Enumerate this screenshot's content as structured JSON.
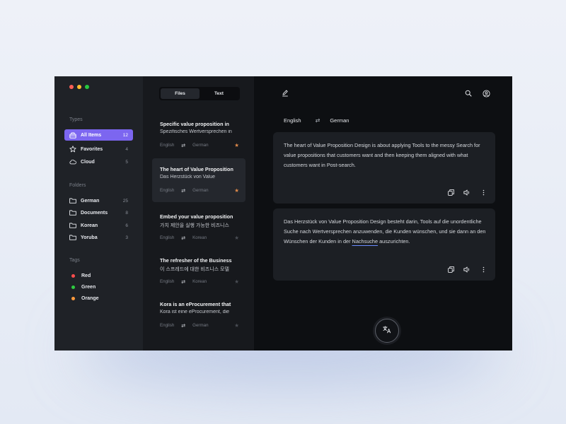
{
  "window": {
    "traffic_lights": [
      {
        "name": "close",
        "color": "#ff5f56"
      },
      {
        "name": "minimize",
        "color": "#ffbd2e"
      },
      {
        "name": "zoom",
        "color": "#27c93f"
      }
    ]
  },
  "sidebar": {
    "types_title": "Types",
    "types": [
      {
        "label": "All Items",
        "count": "12",
        "icon": "inbox-icon",
        "active": true
      },
      {
        "label": "Favorites",
        "count": "4",
        "icon": "star-icon",
        "active": false
      },
      {
        "label": "Cloud",
        "count": "5",
        "icon": "cloud-icon",
        "active": false
      }
    ],
    "folders_title": "Folders",
    "folders": [
      {
        "label": "German",
        "count": "25",
        "icon": "folder-icon"
      },
      {
        "label": "Documents",
        "count": "8",
        "icon": "folder-icon"
      },
      {
        "label": "Korean",
        "count": "6",
        "icon": "folder-icon"
      },
      {
        "label": "Yoruba",
        "count": "3",
        "icon": "folder-icon"
      }
    ],
    "tags_title": "Tags",
    "tags": [
      {
        "label": "Red",
        "color": "#ff4d4d"
      },
      {
        "label": "Green",
        "color": "#2ecc40"
      },
      {
        "label": "Orange",
        "color": "#ff9a3c"
      }
    ]
  },
  "list": {
    "tabs": [
      {
        "label": "Files",
        "active": true
      },
      {
        "label": "Text",
        "active": false
      }
    ],
    "items": [
      {
        "title": "Specific value proposition in",
        "subtitle": "Spezifisches Wertversprechen in",
        "from": "English",
        "to": "German",
        "favorite": true,
        "selected": false
      },
      {
        "title": "The heart of Value Proposition",
        "subtitle": "Das Herzstück von Value",
        "from": "English",
        "to": "German",
        "favorite": true,
        "selected": true
      },
      {
        "title": "Embed your value proposition",
        "subtitle": "가치 제안을 실행 가능한 비즈니스",
        "from": "English",
        "to": "Korean",
        "favorite": false,
        "selected": false
      },
      {
        "title": "The refresher of the Business",
        "subtitle": "이 스프레드에 대한 비즈니스 모델",
        "from": "English",
        "to": "Korean",
        "favorite": false,
        "selected": false
      },
      {
        "title": "Kora is an eProcurement that",
        "subtitle": "Kora ist eine eProcurement, die",
        "from": "English",
        "to": "German",
        "favorite": false,
        "selected": false
      }
    ]
  },
  "main": {
    "source_lang": "English",
    "target_lang": "German",
    "source_text": "The heart of Value Proposition Design is about applying Tools to the messy Search for value propositions that customers want and then keeping them aligned with what customers want in Post-search.",
    "target_text_before": "Das Herzstück von Value Proposition Design besteht darin, Tools auf die unordentliche Suche nach Wertversprechen anzuwenden, die Kunden wünschen, und sie dann an den Wünschen der Kunden in der ",
    "target_text_highlight": "Nachsuche",
    "target_text_after": " auszurichten."
  },
  "colors": {
    "accent": "#7c66f0",
    "favorite_star": "#e08a4a"
  }
}
